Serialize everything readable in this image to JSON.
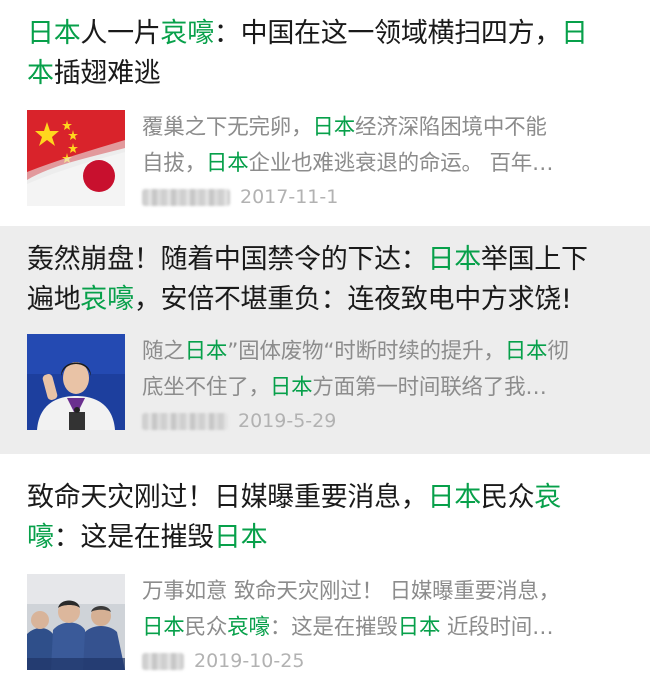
{
  "articles": [
    {
      "title_parts": [
        {
          "text": "日本",
          "kw": true
        },
        {
          "text": "人一片",
          "kw": false
        },
        {
          "text": "哀嚎",
          "kw": true
        },
        {
          "text": "：中国在这一领域横扫四方，",
          "kw": false
        },
        {
          "text": "日本",
          "kw": true
        },
        {
          "text": "插翅难逃",
          "kw": false
        }
      ],
      "snippet_parts": [
        {
          "text": "覆巢之下无完卵，",
          "kw": false
        },
        {
          "text": "日本",
          "kw": true
        },
        {
          "text": "经济深陷困境中不能自拔，",
          "kw": false
        },
        {
          "text": "日本",
          "kw": true
        },
        {
          "text": "企业也难逃衰退的命运。 百年…",
          "kw": false
        }
      ],
      "date": "2017-11-1",
      "image": "china-japan-flags-image"
    },
    {
      "title_parts": [
        {
          "text": "轰然崩盘！随着中国禁令的下达：",
          "kw": false
        },
        {
          "text": "日本",
          "kw": true
        },
        {
          "text": "举国上下遍地",
          "kw": false
        },
        {
          "text": "哀嚎",
          "kw": true
        },
        {
          "text": "，安倍不堪重负：连夜致电中方求饶!",
          "kw": false
        }
      ],
      "snippet_parts": [
        {
          "text": "随之",
          "kw": false
        },
        {
          "text": "日本",
          "kw": true
        },
        {
          "text": "”固体废物“时断时续的提升，",
          "kw": false
        },
        {
          "text": "日本",
          "kw": true
        },
        {
          "text": "彻底坐不住了，",
          "kw": false
        },
        {
          "text": "日本",
          "kw": true
        },
        {
          "text": "方面第一时间联络了我…",
          "kw": false
        }
      ],
      "date": "2019-5-29",
      "image": "spokeswoman-podium-image"
    },
    {
      "title_parts": [
        {
          "text": "致命天灾刚过！日媒曝重要消息，",
          "kw": false
        },
        {
          "text": "日本",
          "kw": true
        },
        {
          "text": "民众",
          "kw": false
        },
        {
          "text": "哀嚎",
          "kw": true
        },
        {
          "text": "：这是在摧毁",
          "kw": false
        },
        {
          "text": "日本",
          "kw": true
        }
      ],
      "snippet_parts": [
        {
          "text": "万事如意 致命天灾刚过！ 日媒曝重要消息，",
          "kw": false
        },
        {
          "text": "日本",
          "kw": true
        },
        {
          "text": "民众",
          "kw": false
        },
        {
          "text": "哀嚎",
          "kw": true
        },
        {
          "text": "：这是在摧毁",
          "kw": false
        },
        {
          "text": "日本",
          "kw": true
        },
        {
          "text": " 近段时间…",
          "kw": false
        }
      ],
      "date": "2019-10-25",
      "image": "officials-meeting-image"
    }
  ],
  "colors": {
    "keyword": "#07a04a",
    "title": "#1a1a1a",
    "snippet": "#8c8c8c",
    "meta": "#b2b2b2",
    "highlight_bg": "#ededed"
  }
}
